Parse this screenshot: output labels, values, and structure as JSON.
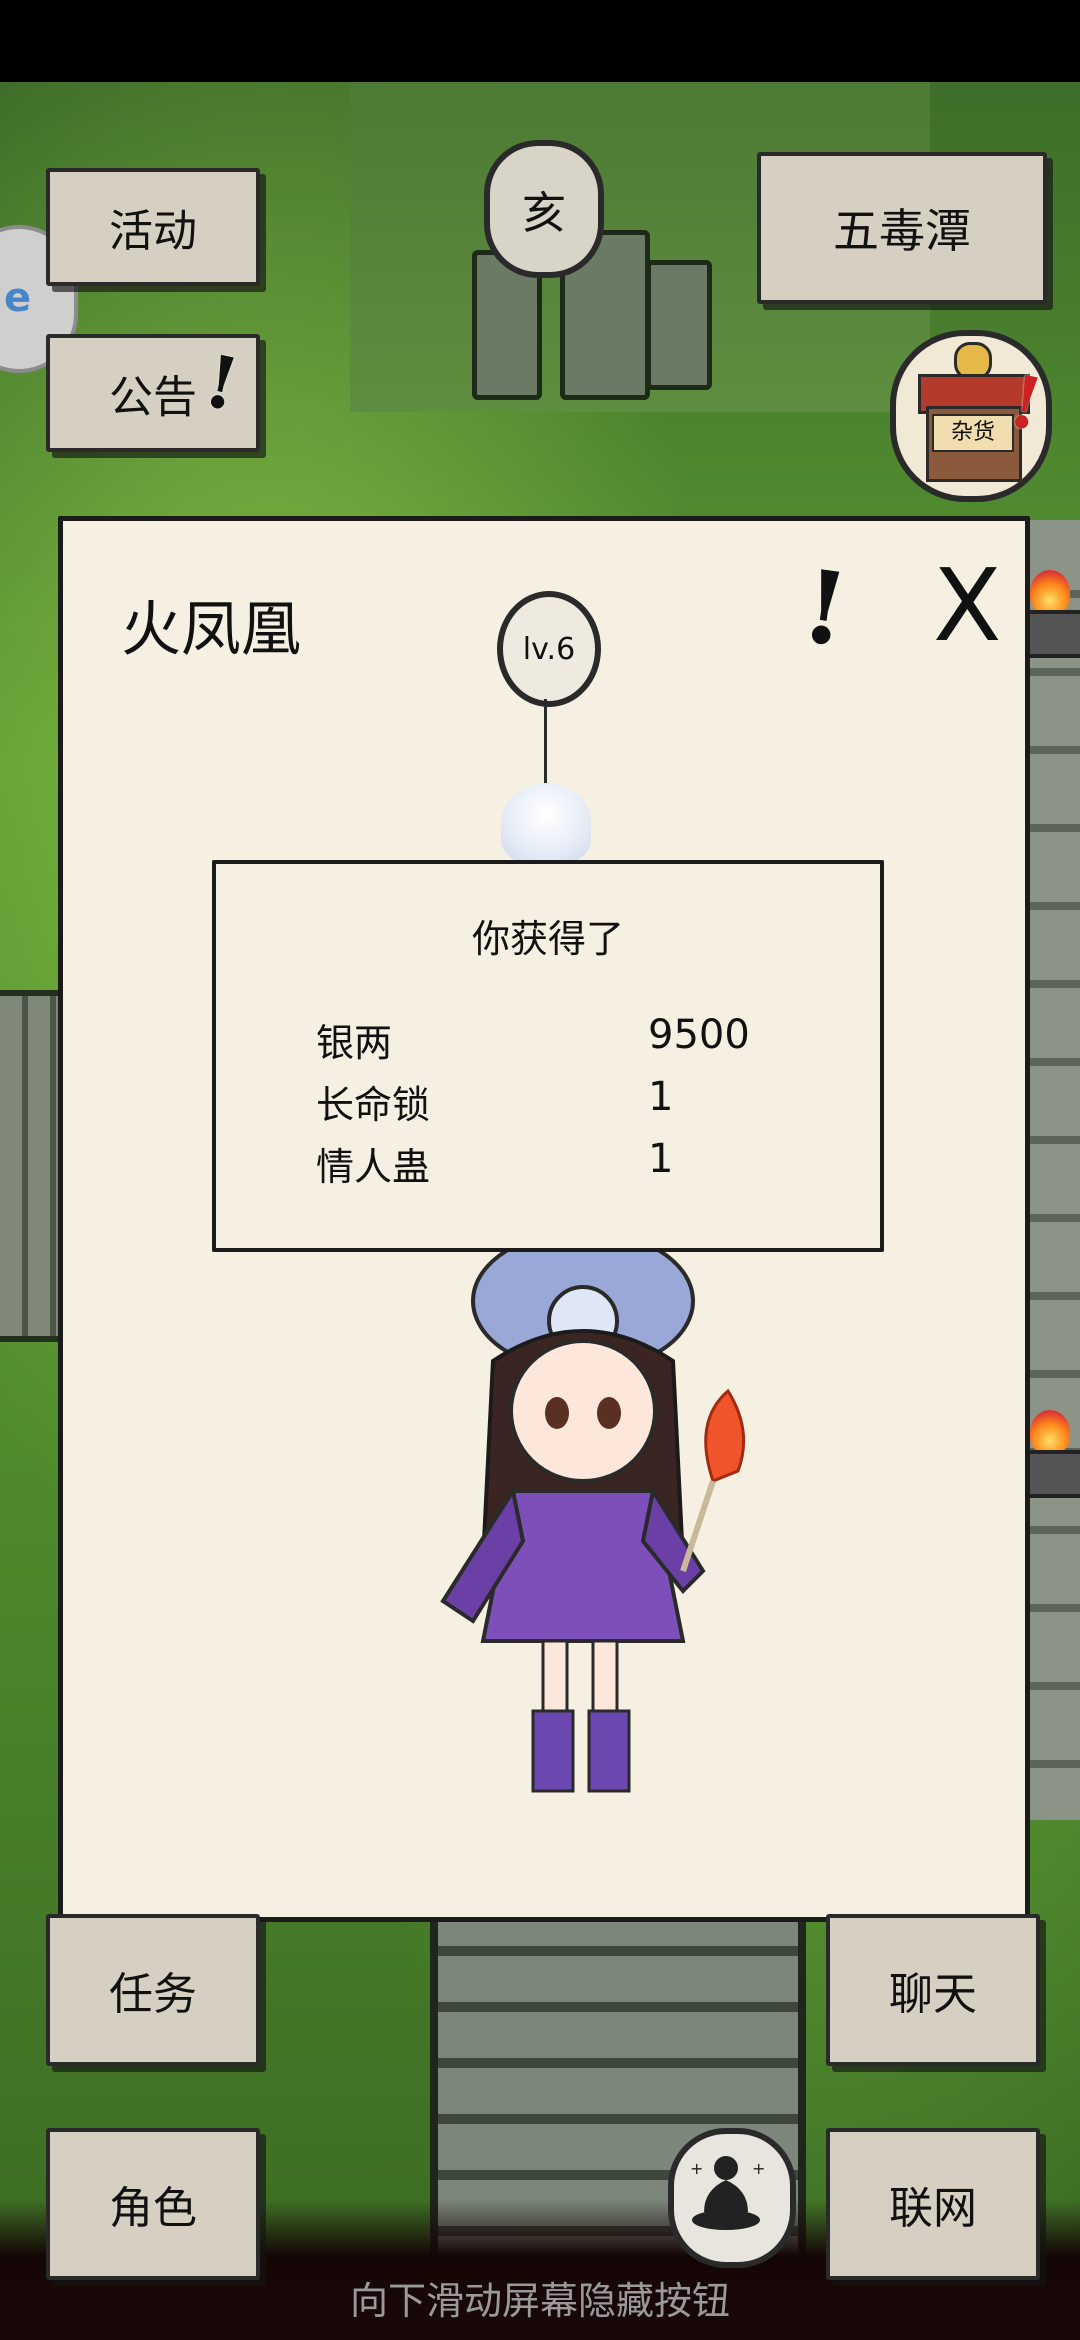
{
  "top_menu": {
    "activity_label": "活动",
    "notice_label": "公告",
    "location_label": "五毒潭",
    "time_glyph": "亥",
    "notice_alert": "!",
    "shop_alert": "!",
    "shop_sign": "杂货",
    "side_bubble_text": "e"
  },
  "detail_panel": {
    "title": "火凤凰",
    "info_mark": "!",
    "close_mark": "X",
    "level": "lv.6"
  },
  "reward_dialog": {
    "heading": "你获得了",
    "items": [
      {
        "name": "银两",
        "quantity": "9500"
      },
      {
        "name": "长命锁",
        "quantity": "1"
      },
      {
        "name": "情人蛊",
        "quantity": "1"
      }
    ]
  },
  "bottom_menu": {
    "task_label": "任务",
    "chat_label": "聊天",
    "character_label": "角色",
    "network_label": "联网"
  },
  "footer": {
    "hint": "向下滑动屏幕隐藏按钮"
  },
  "icons": {
    "time": "time-medallion-icon",
    "shop": "shop-icon",
    "meditate": "meditate-icon"
  }
}
